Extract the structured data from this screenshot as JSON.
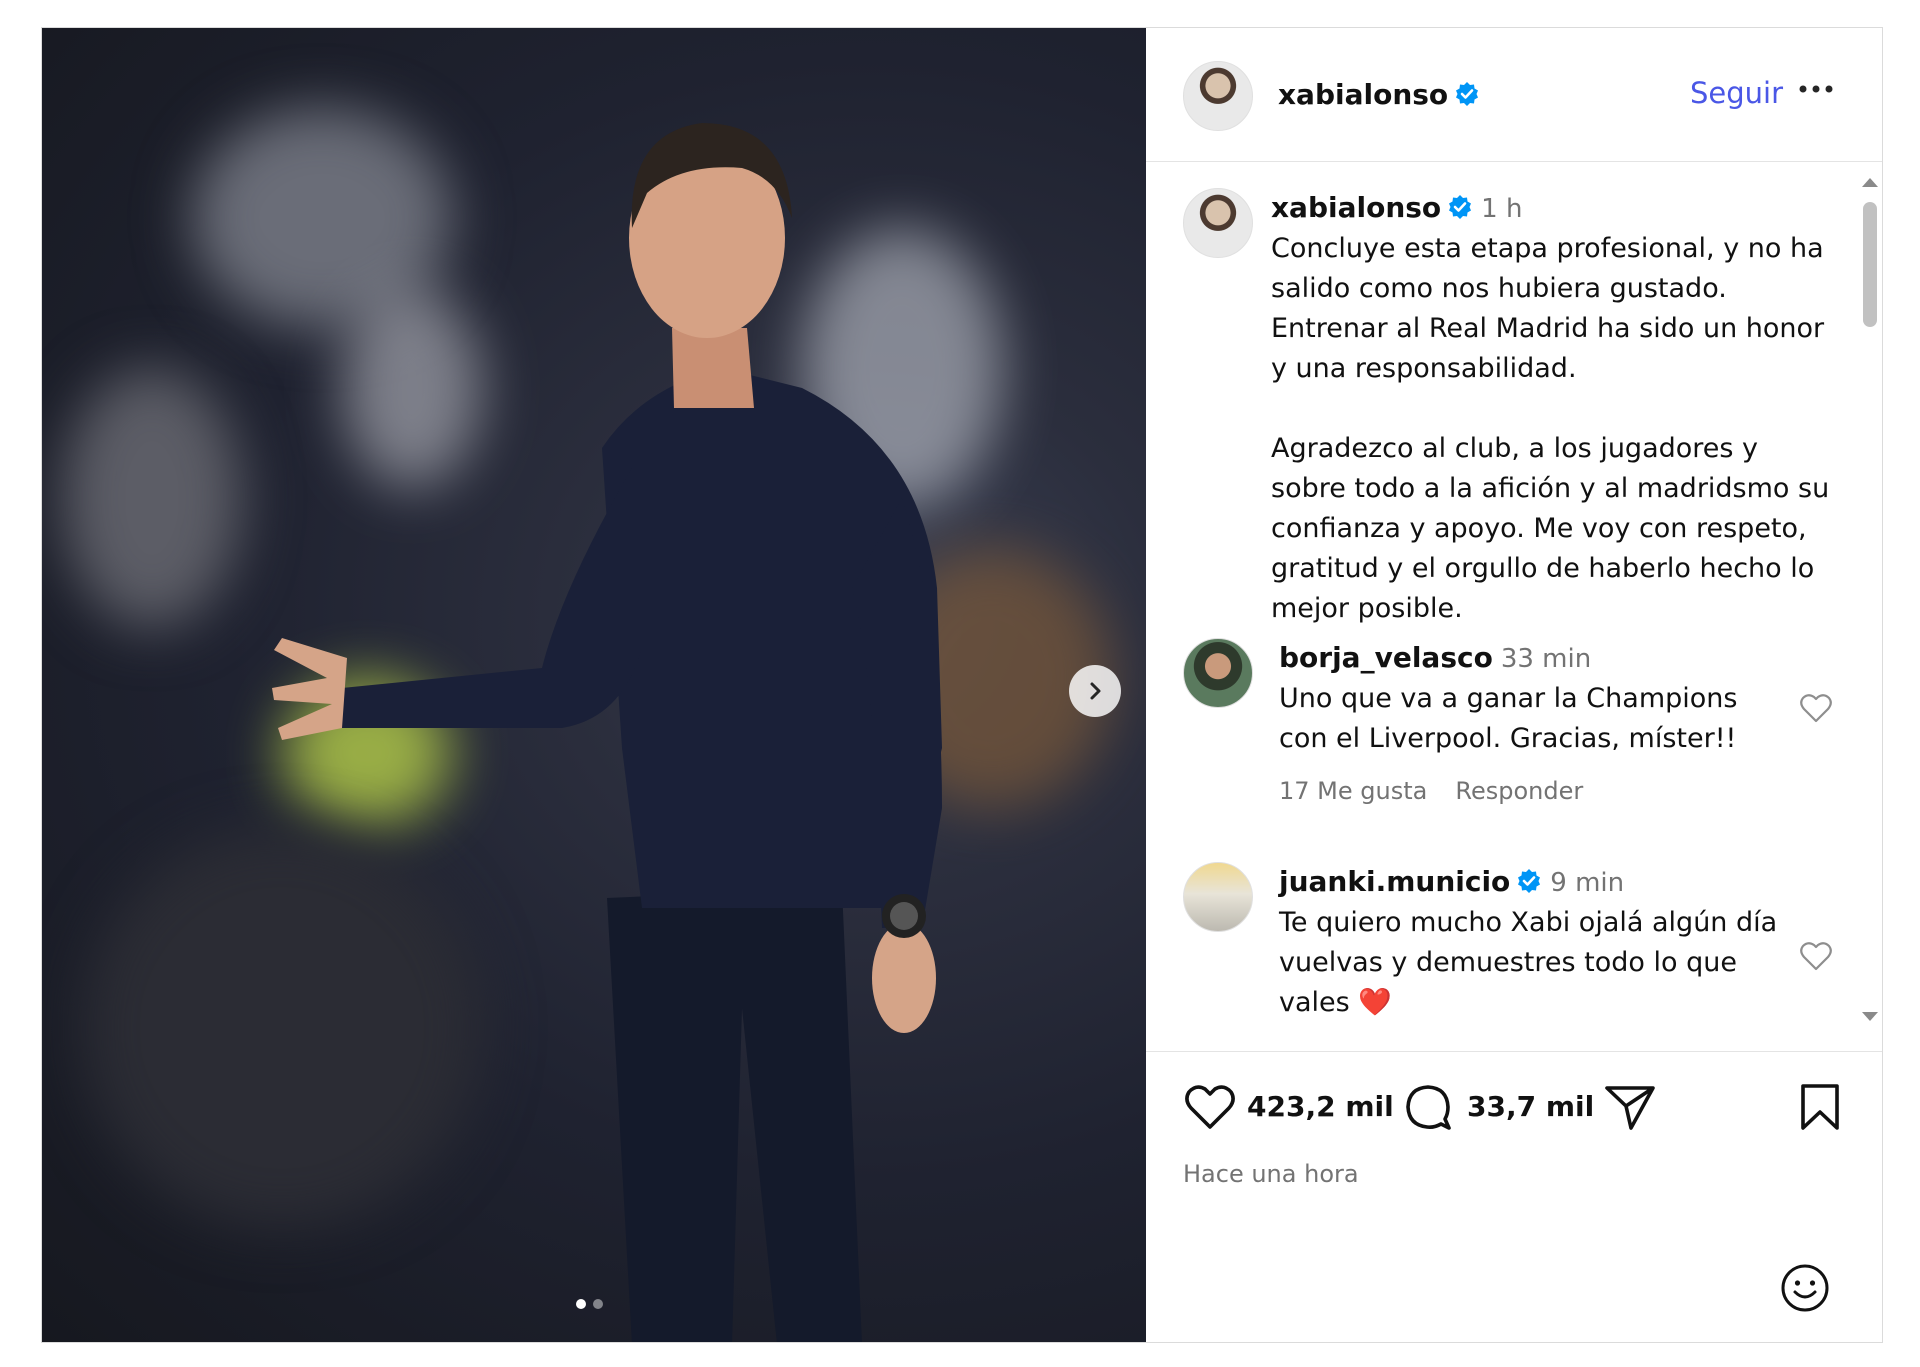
{
  "post": {
    "username": "xabialonso",
    "verified": true,
    "follow_label": "Seguir",
    "caption": {
      "username": "xabialonso",
      "time": "1 h",
      "text": "Concluye esta etapa profesional, y no ha salido como nos hubiera gustado. Entrenar al Real Madrid ha sido un honor y una responsabilidad.\n\nAgradezco al club, a los jugadores y sobre todo a la afición y al madridsmo su confianza y apoyo. Me voy con respeto, gratitud y el orgullo de haberlo hecho lo mejor posible."
    },
    "comments": [
      {
        "username": "borja_velasco",
        "verified": false,
        "time": "33 min",
        "text": "Uno que va a ganar la Champions con el Liverpool. Gracias, míster!!",
        "likes": "17 Me gusta",
        "reply_label": "Responder"
      },
      {
        "username": "juanki.municio",
        "verified": true,
        "time": "9 min",
        "text": "Te quiero mucho Xabi ojalá algún día vuelvas y demuestres todo lo que vales ❤️"
      }
    ],
    "likes_count": "423,2 mil",
    "comments_count": "33,7 mil",
    "posted": "Hace una hora",
    "carousel": {
      "current": 1,
      "total": 2
    },
    "icons": {
      "verified": "verified-badge-icon",
      "more": "more-options-icon",
      "next": "chevron-right-icon",
      "like": "heart-icon",
      "comment": "comment-bubble-icon",
      "share": "paper-plane-icon",
      "save": "bookmark-icon",
      "emoji": "smiley-icon"
    },
    "colors": {
      "follow": "#4a57e6",
      "verified": "#0095f6",
      "secondary_text": "#737373"
    }
  }
}
